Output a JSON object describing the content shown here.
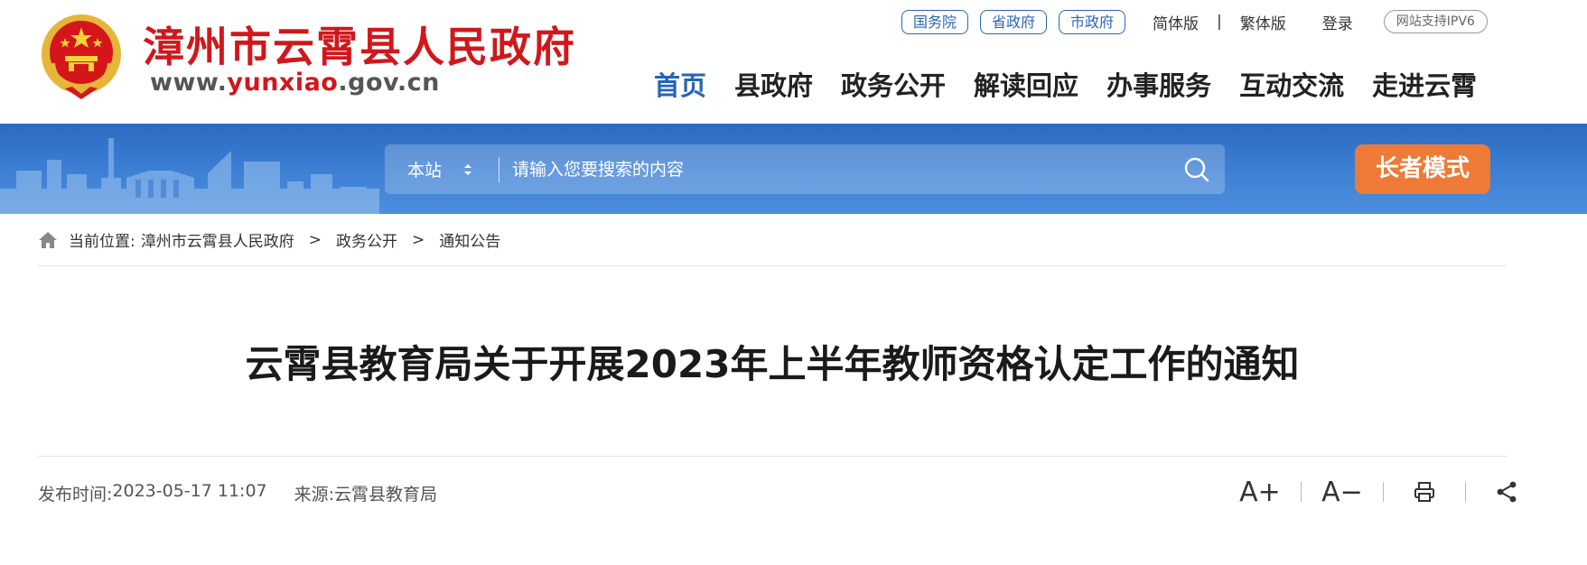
{
  "header": {
    "title": "漳州市云霄县人民政府",
    "url_prefix": "www.",
    "url_highlight": "yunxiao",
    "url_suffix": ".gov.cn",
    "top_links": {
      "guowuyuan": "国务院",
      "shengzhengfu": "省政府",
      "shizhengfu": "市政府",
      "simplified": "简体版",
      "separator": "|",
      "traditional": "繁体版",
      "login": "登录",
      "ipv6": "网站支持IPV6"
    },
    "nav": [
      {
        "label": "首页",
        "active": true
      },
      {
        "label": "县政府"
      },
      {
        "label": "政务公开"
      },
      {
        "label": "解读回应"
      },
      {
        "label": "办事服务"
      },
      {
        "label": "互动交流"
      },
      {
        "label": "走进云霄"
      }
    ]
  },
  "search": {
    "scope": "本站",
    "placeholder": "请输入您要搜索的内容",
    "search_icon": "search-icon"
  },
  "elder_mode": "长者模式",
  "breadcrumb": {
    "label": "当前位置:",
    "items": [
      "漳州市云霄县人民政府",
      "政务公开",
      "通知公告"
    ],
    "separator": ">"
  },
  "article": {
    "title": "云霄县教育局关于开展2023年上半年教师资格认定工作的通知",
    "publish_label": "发布时间:",
    "publish_time": "2023-05-17 11:07",
    "source_label": "来源:",
    "source": "云霄县教育局"
  },
  "tools": {
    "font_increase": "A+",
    "font_decrease": "A−",
    "print_icon": "print-icon",
    "share_icon": "share-icon"
  },
  "colors": {
    "brand_red": "#d0181c",
    "nav_blue": "#2466b2",
    "banner_blue": "#3f82d6",
    "elder_orange": "#ee7a37"
  }
}
